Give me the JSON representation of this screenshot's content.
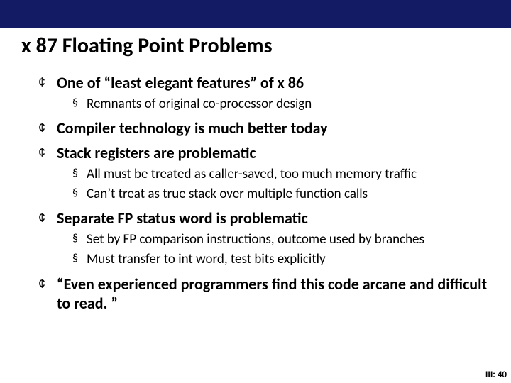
{
  "title": "x 87  Floating Point Problems",
  "bullets": {
    "b1": "One of “least elegant features” of x 86",
    "b1s1": "Remnants of original co-processor design",
    "b2": "Compiler technology is much better today",
    "b3": "Stack registers are problematic",
    "b3s1": "All must be treated as caller-saved, too much memory traffic",
    "b3s2": "Can’t treat as true stack over multiple function calls",
    "b4": "Separate FP status word is problematic",
    "b4s1": "Set by FP comparison instructions, outcome used by branches",
    "b4s2": "Must transfer to int word, test bits explicitly",
    "b5": "“Even experienced programmers find this code arcane and difficult to read. ”"
  },
  "footer": "III: 40"
}
